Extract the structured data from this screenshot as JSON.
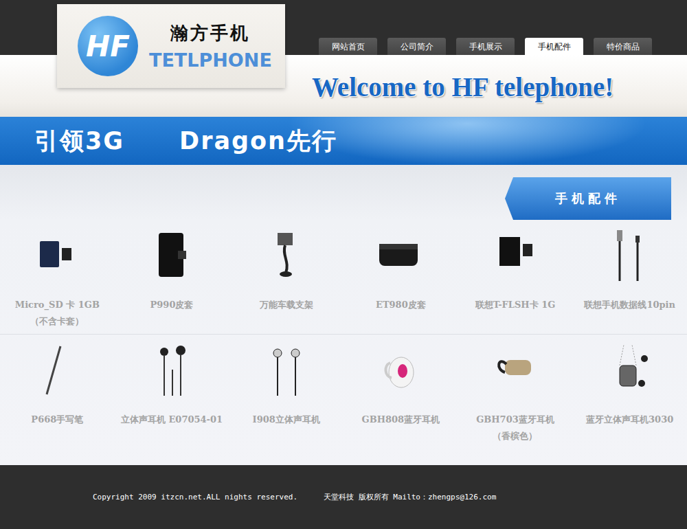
{
  "logo": {
    "mark": "HF",
    "name": "瀚方手机",
    "subtitle": "TETLPHONE"
  },
  "nav": [
    {
      "label": "网站首页",
      "selected": false
    },
    {
      "label": "公司简介",
      "selected": false
    },
    {
      "label": "手机展示",
      "selected": false
    },
    {
      "label": "手机配件",
      "selected": true
    },
    {
      "label": "特价商品",
      "selected": false
    }
  ],
  "welcome": "Welcome to HF telephone!",
  "banner": [
    "引领3G",
    "Dragon先行"
  ],
  "section_title": "手机配件",
  "product_rows": [
    [
      {
        "lines": [
          "Micro_SD 卡 1GB",
          "（不含卡套）"
        ]
      },
      {
        "lines": [
          "P990皮套"
        ]
      },
      {
        "lines": [
          "万能车载支架"
        ]
      },
      {
        "lines": [
          "ET980皮套"
        ]
      },
      {
        "lines": [
          "联想T-FLSH卡 1G"
        ]
      },
      {
        "lines": [
          "联想手机数据线10pin"
        ]
      }
    ],
    [
      {
        "lines": [
          "P668手写笔"
        ]
      },
      {
        "lines": [
          "立体声耳机 E07054-01"
        ]
      },
      {
        "lines": [
          "I908立体声耳机"
        ]
      },
      {
        "lines": [
          "GBH808蓝牙耳机"
        ]
      },
      {
        "lines": [
          "GBH703蓝牙耳机",
          "（香槟色）"
        ]
      },
      {
        "lines": [
          "蓝牙立体声耳机3030"
        ]
      }
    ]
  ],
  "footer": [
    "Copyright 2009 itzcn.net.ALL nights reserved.",
    "天堂科技 版权所有 Mailto：zhengps@126.com"
  ]
}
